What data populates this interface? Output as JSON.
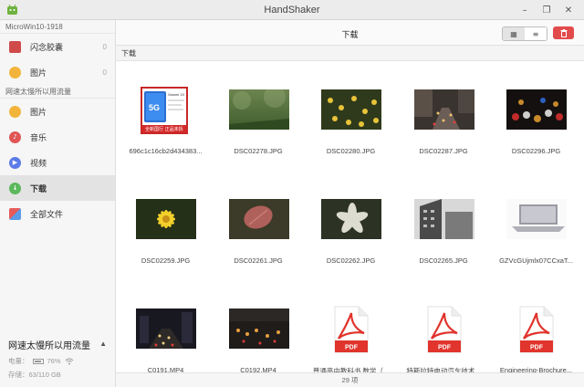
{
  "window": {
    "title": "HandShaker",
    "minimize_icon": "–",
    "restore_icon": "❐",
    "close_icon": "✕"
  },
  "sidebar": {
    "device_title": "MicroWin10-1918",
    "device_items": [
      {
        "label": "闪念胶囊",
        "count": "0",
        "icon": "capsule-icon",
        "color": "#d04a4a",
        "glyph": ""
      },
      {
        "label": "图片",
        "count": "0",
        "icon": "image-icon",
        "color": "#f2b43a",
        "glyph": ""
      }
    ],
    "phone_title": "网速太慢所以用流量",
    "phone_items": [
      {
        "label": "图片",
        "icon": "image-icon",
        "color": "#f2b43a",
        "glyph": ""
      },
      {
        "label": "音乐",
        "icon": "music-icon",
        "color": "#e05656",
        "glyph": "♪"
      },
      {
        "label": "视频",
        "icon": "video-icon",
        "color": "#5b7be8",
        "glyph": "▶"
      },
      {
        "label": "下载",
        "icon": "download-icon",
        "color": "#5cb85c",
        "glyph": "↓"
      },
      {
        "label": "全部文件",
        "icon": "all-files-icon",
        "color": "#e88a3a",
        "glyph": ""
      }
    ],
    "device_panel": {
      "name": "网速太慢所以用流量",
      "eject_icon": "▲",
      "battery_label": "电量：",
      "battery_value": "76%",
      "battery_level": 0.76,
      "storage_label": "存储：",
      "storage_value": "63/110 GB"
    }
  },
  "toolbar": {
    "title": "下载",
    "grid_icon": "▦",
    "list_icon": "≡",
    "delete_icon": "🗑"
  },
  "breadcrumb": "下载",
  "files": [
    {
      "name": "696c1c16cb2d434383...",
      "kind": "promo"
    },
    {
      "name": "DSC02278.JPG",
      "kind": "grass"
    },
    {
      "name": "DSC02280.JPG",
      "kind": "flowers"
    },
    {
      "name": "DSC02287.JPG",
      "kind": "street"
    },
    {
      "name": "DSC02296.JPG",
      "kind": "bokeh"
    },
    {
      "name": "DSC02259.JPG",
      "kind": "yellowflower"
    },
    {
      "name": "DSC02261.JPG",
      "kind": "leaf"
    },
    {
      "name": "DSC02262.JPG",
      "kind": "whiteflower"
    },
    {
      "name": "DSC02265.JPG",
      "kind": "building"
    },
    {
      "name": "GZVcGUjmlx07CCxaT...",
      "kind": "laptop"
    },
    {
      "name": "C0191.MP4",
      "kind": "nightcity"
    },
    {
      "name": "C0192.MP4",
      "kind": "nightcity2"
    },
    {
      "name": "普通高中教科书 数学（...",
      "kind": "pdf"
    },
    {
      "name": "特斯拉特电动汽车技术...",
      "kind": "pdf"
    },
    {
      "name": "Engineering-Brochure...",
      "kind": "pdf"
    }
  ],
  "promo_text": {
    "brand": "Xiaomi 10",
    "badge": "5G",
    "line": "全新国行 正品未拆"
  },
  "pdf_label": "PDF",
  "status": "29 项"
}
